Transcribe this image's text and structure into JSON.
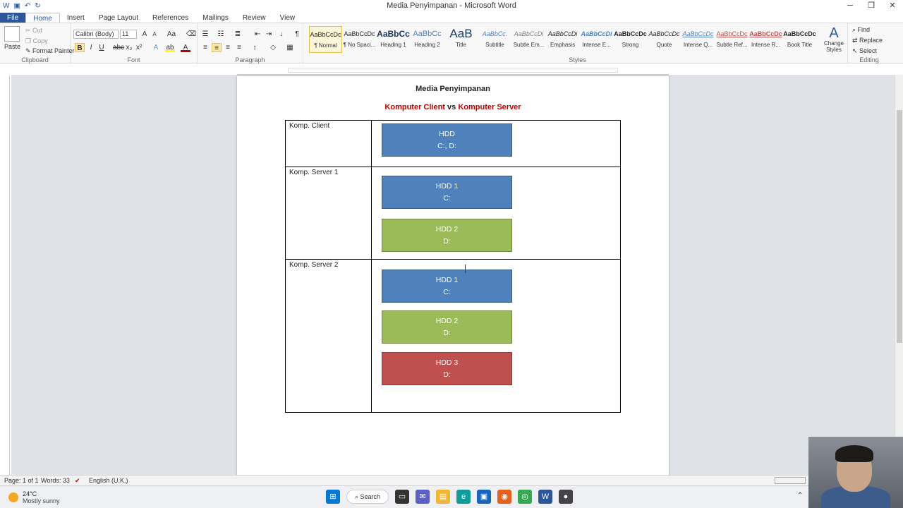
{
  "window": {
    "title": "Media Penyimpanan - Microsoft Word"
  },
  "tabs": [
    "File",
    "Home",
    "Insert",
    "Page Layout",
    "References",
    "Mailings",
    "Review",
    "View"
  ],
  "clipboard": {
    "paste": "Paste",
    "cut": "Cut",
    "copy": "Copy",
    "format_painter": "Format Painter",
    "label": "Clipboard"
  },
  "font": {
    "name": "Calibri (Body)",
    "size": "11",
    "label": "Font"
  },
  "paragraph": {
    "label": "Paragraph"
  },
  "styles": {
    "label": "Styles",
    "items": [
      {
        "preview": "AaBbCcDc",
        "name": "¶ Normal"
      },
      {
        "preview": "AaBbCcDc",
        "name": "¶ No Spaci..."
      },
      {
        "preview": "AaBbCc",
        "name": "Heading 1"
      },
      {
        "preview": "AaBbCc",
        "name": "Heading 2"
      },
      {
        "preview": "AaB",
        "name": "Title"
      },
      {
        "preview": "AaBbCc.",
        "name": "Subtitle"
      },
      {
        "preview": "AaBbCcDi",
        "name": "Subtle Em..."
      },
      {
        "preview": "AaBbCcDi",
        "name": "Emphasis"
      },
      {
        "preview": "AaBbCcDi",
        "name": "Intense E..."
      },
      {
        "preview": "AaBbCcDc",
        "name": "Strong"
      },
      {
        "preview": "AaBbCcDc",
        "name": "Quote"
      },
      {
        "preview": "AaBbCcDc",
        "name": "Intense Q..."
      },
      {
        "preview": "AaBbCcDc",
        "name": "Subtle Ref..."
      },
      {
        "preview": "AaBbCcDc",
        "name": "Intense R..."
      },
      {
        "preview": "AaBbCcDc",
        "name": "Book Title"
      }
    ],
    "change_styles": "Change Styles"
  },
  "editing": {
    "find": "Find",
    "replace": "Replace",
    "select": "Select",
    "label": "Editing"
  },
  "document": {
    "title": "Media Penyimpanan",
    "subtitle_part1": "Komputer Client",
    "subtitle_vs": " vs ",
    "subtitle_part2": "Komputer Server",
    "rows": [
      {
        "label": "Komp. Client",
        "drives": [
          {
            "name": "HDD",
            "letter": "C:, D:"
          }
        ]
      },
      {
        "label": "Komp. Server 1",
        "drives": [
          {
            "name": "HDD 1",
            "letter": "C:"
          },
          {
            "name": "HDD 2",
            "letter": "D:"
          }
        ]
      },
      {
        "label": "Komp. Server 2",
        "drives": [
          {
            "name": "HDD 1",
            "letter": "C:"
          },
          {
            "name": "HDD 2",
            "letter": "D:"
          },
          {
            "name": "HDD 3",
            "letter": "D:"
          }
        ]
      }
    ]
  },
  "status": {
    "page": "Page: 1 of 1",
    "words": "Words: 33",
    "language": "English (U.K.)"
  },
  "taskbar": {
    "temp": "24°C",
    "weather": "Mostly sunny",
    "search": "Search"
  },
  "colors": {
    "blue": "#4f81bd",
    "green": "#9bbb59",
    "red": "#c0504d",
    "word_blue": "#2b579a"
  }
}
